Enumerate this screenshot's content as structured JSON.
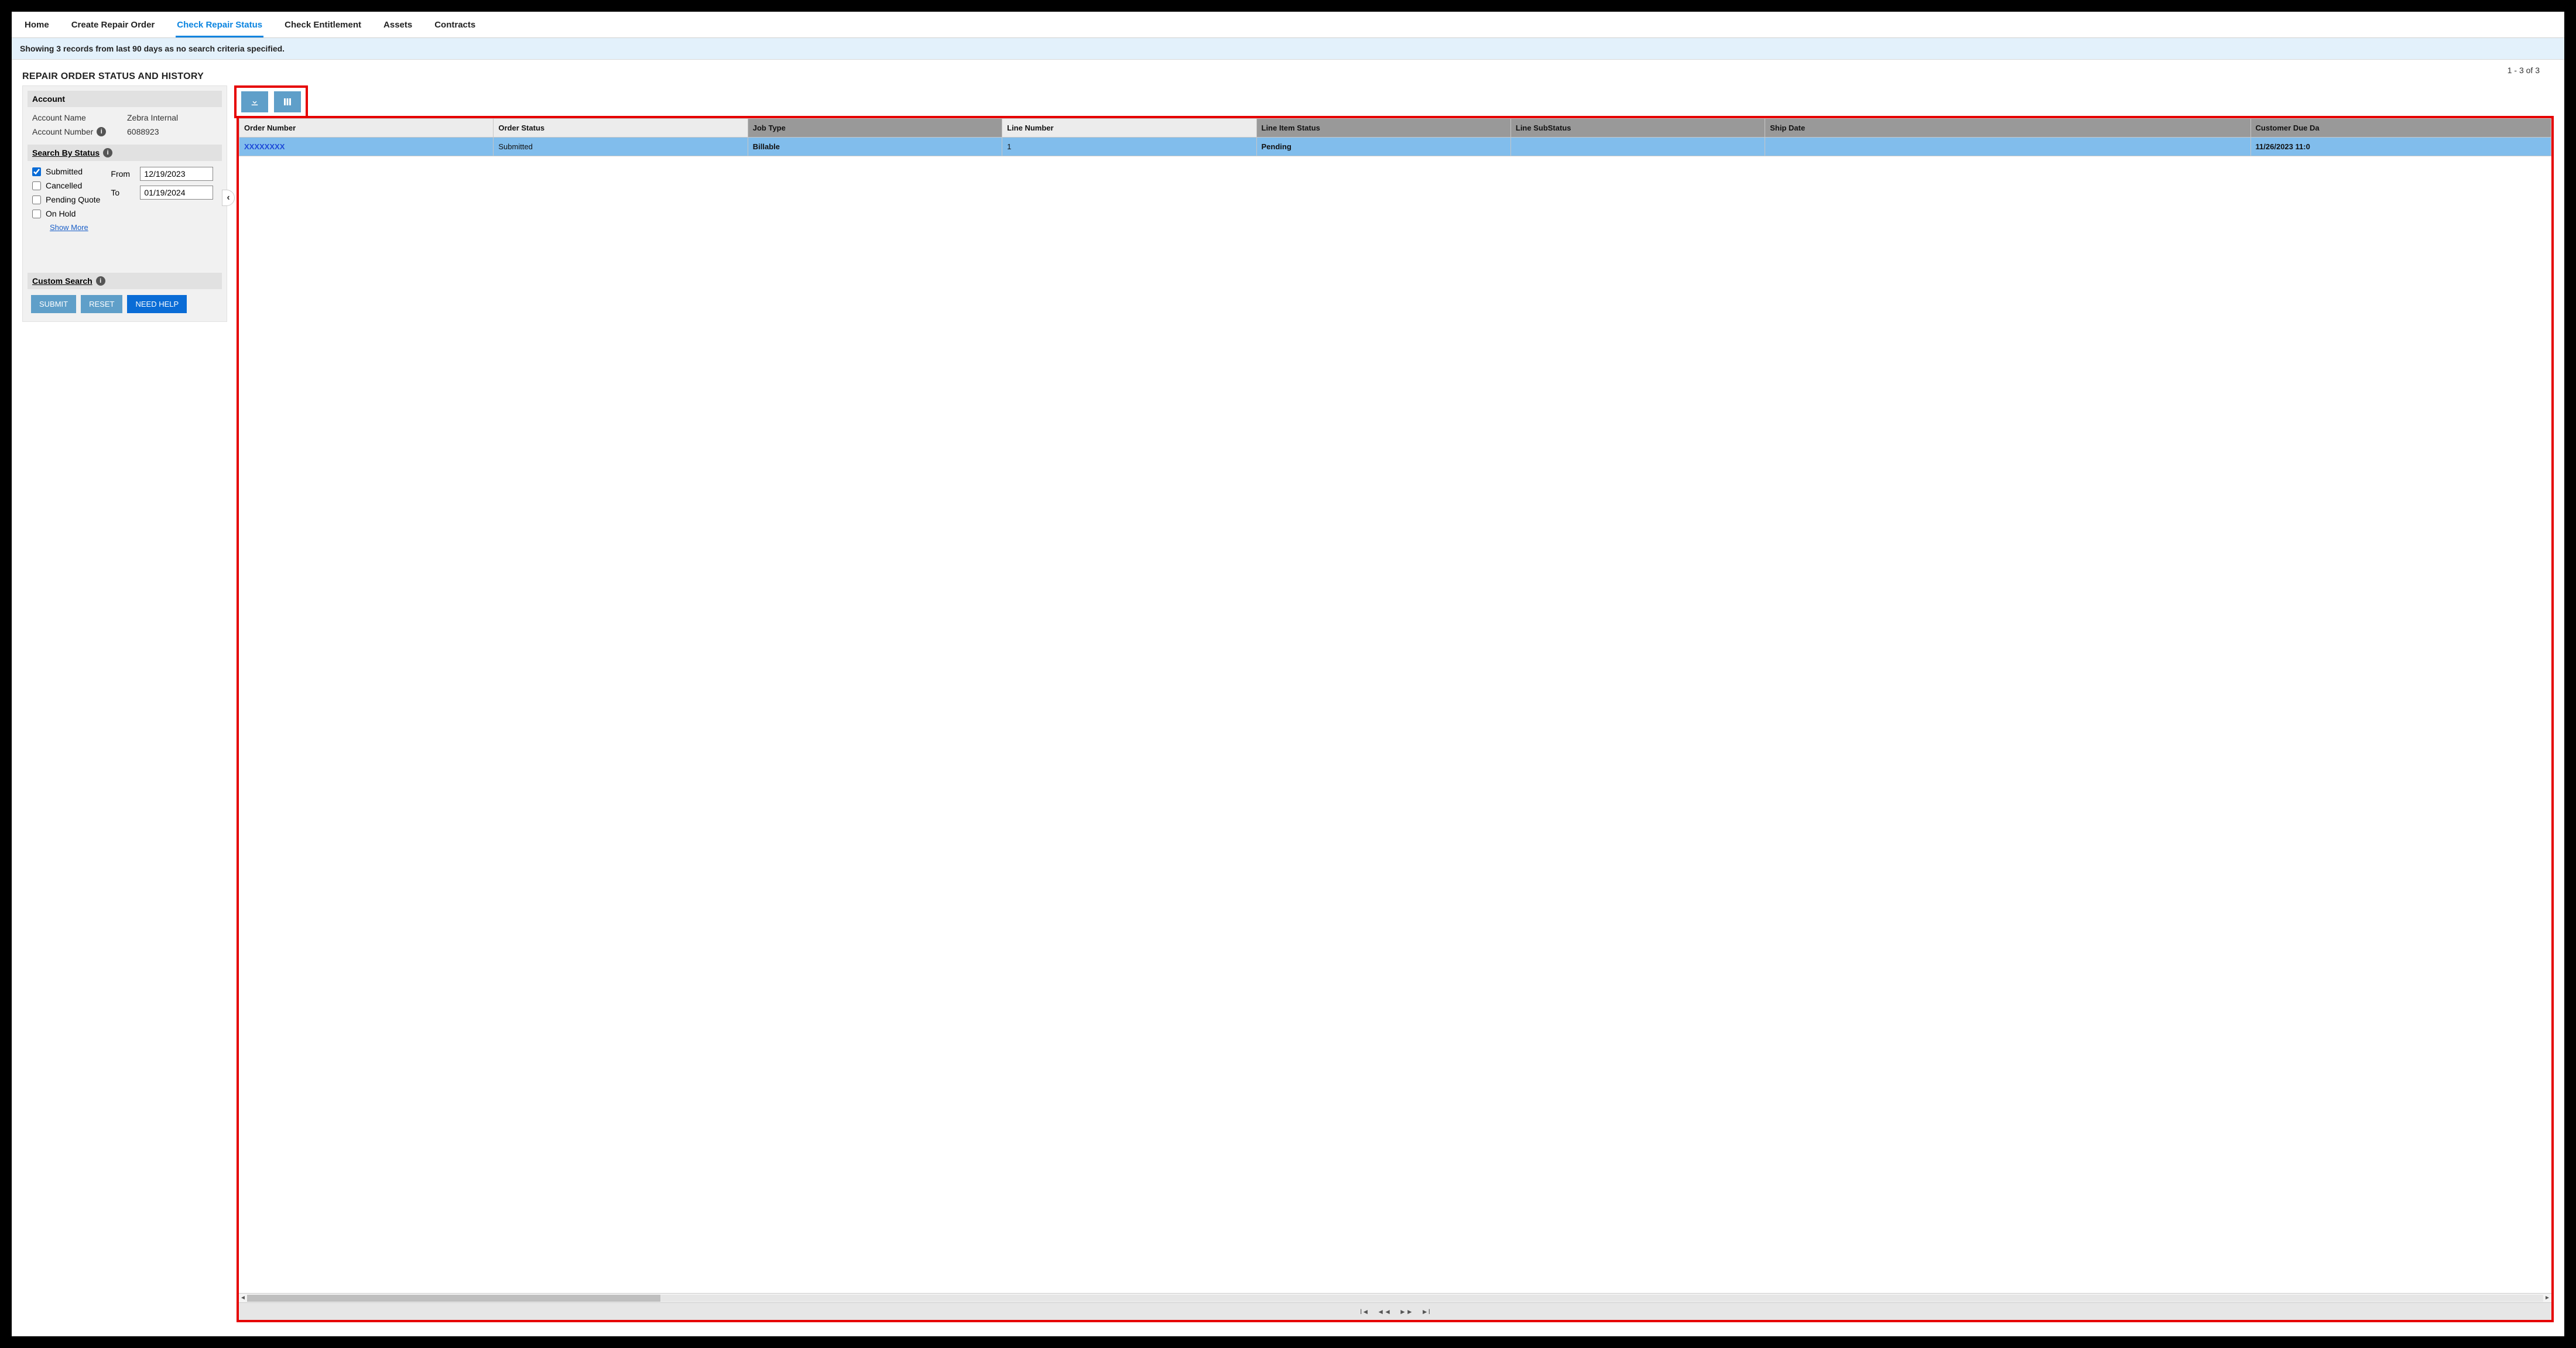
{
  "tabs": [
    {
      "label": "Home",
      "active": false
    },
    {
      "label": "Create Repair Order",
      "active": false
    },
    {
      "label": "Check Repair Status",
      "active": true
    },
    {
      "label": "Check Entitlement",
      "active": false
    },
    {
      "label": "Assets",
      "active": false
    },
    {
      "label": "Contracts",
      "active": false
    }
  ],
  "notice": "Showing 3 records from last 90 days as no search criteria specified.",
  "page_title": "REPAIR ORDER STATUS AND HISTORY",
  "record_count": "1 - 3 of 3",
  "sidebar": {
    "account": {
      "title": "Account",
      "name_label": "Account Name",
      "name_value": "Zebra Internal",
      "number_label": "Account Number",
      "number_value": "6088923"
    },
    "status": {
      "title": "Search By Status",
      "checks": [
        {
          "label": "Submitted",
          "checked": true
        },
        {
          "label": "Cancelled",
          "checked": false
        },
        {
          "label": "Pending Quote",
          "checked": false
        },
        {
          "label": "On Hold",
          "checked": false
        }
      ],
      "from_label": "From",
      "to_label": "To",
      "from_value": "12/19/2023",
      "to_value": "01/19/2024",
      "show_more": "Show More"
    },
    "custom_search": {
      "title": "Custom Search"
    },
    "buttons": {
      "submit": "SUBMIT",
      "reset": "RESET",
      "help": "NEED HELP"
    }
  },
  "table": {
    "columns": [
      {
        "label": "Order Number",
        "style": "light"
      },
      {
        "label": "Order Status",
        "style": "light"
      },
      {
        "label": "Job Type",
        "style": "dark"
      },
      {
        "label": "Line Number",
        "style": "light"
      },
      {
        "label": "Line Item Status",
        "style": "dark"
      },
      {
        "label": "Line SubStatus",
        "style": "dark"
      },
      {
        "label": "Ship Date",
        "style": "dark"
      },
      {
        "label": "Customer Due Da",
        "style": "dark"
      }
    ],
    "rows": [
      {
        "order_number": "XXXXXXXX",
        "order_status": "Submitted",
        "job_type": "Billable",
        "line_number": "1",
        "line_item_status": "Pending",
        "line_substatus": "",
        "ship_date": "",
        "customer_due": "11/26/2023 11:0"
      }
    ]
  }
}
